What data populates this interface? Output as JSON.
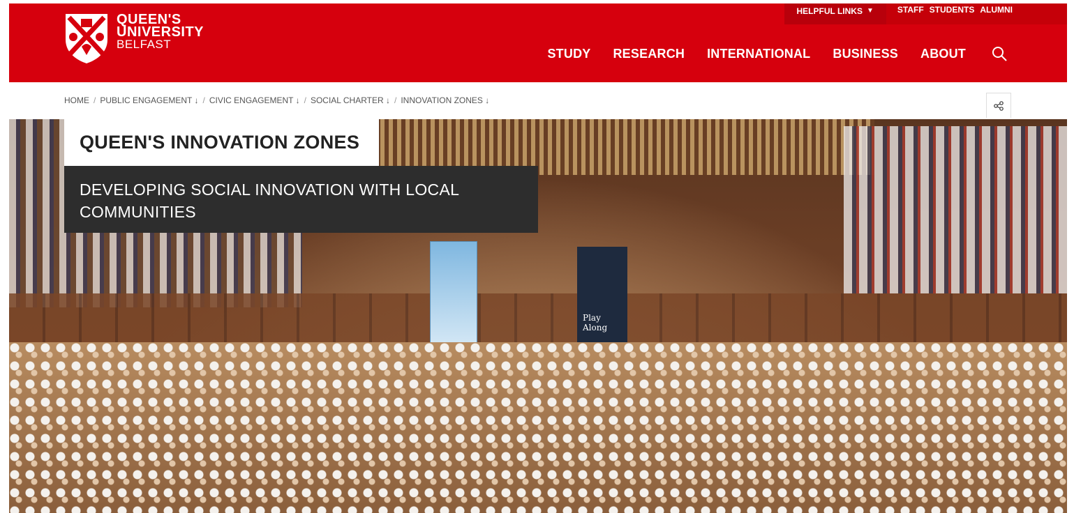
{
  "header": {
    "logo": {
      "line1": "QUEEN'S",
      "line2": "UNIVERSITY",
      "line3": "BELFAST"
    },
    "helpful_links": "HELPFUL LINKS",
    "audience_links": [
      "STAFF",
      "STUDENTS",
      "ALUMNI"
    ],
    "nav": [
      "STUDY",
      "RESEARCH",
      "INTERNATIONAL",
      "BUSINESS",
      "ABOUT"
    ],
    "search_icon": "search-icon",
    "brand_color": "#d6000d"
  },
  "breadcrumb": [
    {
      "label": "HOME",
      "has_menu": false
    },
    {
      "label": "PUBLIC ENGAGEMENT ↓",
      "has_menu": true
    },
    {
      "label": "CIVIC ENGAGEMENT ↓",
      "has_menu": true
    },
    {
      "label": "SOCIAL CHARTER ↓",
      "has_menu": true
    },
    {
      "label": "INNOVATION ZONES ↓",
      "has_menu": true
    }
  ],
  "share_icon": "share-icon",
  "hero": {
    "title": "QUEEN'S INNOVATION ZONES",
    "subtitle_line1": "DEVELOPING SOCIAL INNOVATION WITH LOCAL",
    "subtitle_line2": "COMMUNITIES",
    "banner_text": "Play Along"
  }
}
